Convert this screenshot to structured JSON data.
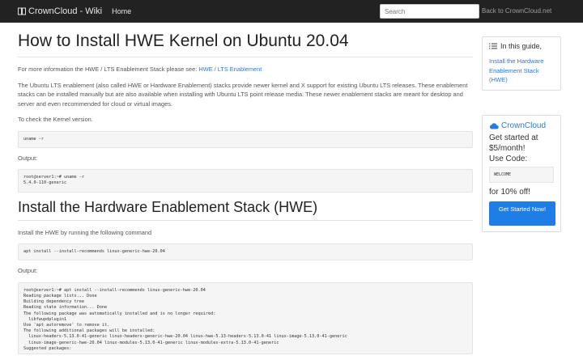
{
  "navbar": {
    "brand": "CrownCloud - Wiki",
    "home": "Home",
    "search_placeholder": "Search",
    "back_link": "Back to CrownCloud.net"
  },
  "main": {
    "title": "How to Install HWE Kernel on Ubuntu 20.04",
    "intro_prefix": "For more information the HWE / LTS Enablement Stack please see:",
    "intro_link": "HWE / LTS Enablement",
    "description": "The Ubuntu LTS enablement (also called HWE or Hardware Enablement) stacks provide newer kernel and X support for existing Ubuntu LTS releases. These enablement stacks can be installed manually but are also available when installing with Ubuntu LTS point release media. These newer enablement stacks are meant for desktop and server and even recommended for cloud or virtual images.",
    "check_kernel": "To check the Kernel version.",
    "cmd_uname": "uname -r",
    "output_label_1": "Output:",
    "output_uname": "root@server1:~# uname -r\n5.4.0-110-generic",
    "section_title": "Install the Hardware Enablement Stack (HWE)",
    "install_text": "Install the HWE by running the following command",
    "cmd_install": "apt install --install-recommends linux-generic-hwe-20.04",
    "output_label_2": "Output:",
    "output_install": "root@server1:~# apt install --install-recommends linux-generic-hwe-20.04\nReading package lists... Done\nBuilding dependency tree\nReading state information... Done\nThe following package was automatically installed and is no longer required:\n  libfwupdplugin1\nUse 'apt autoremove' to remove it.\nThe following additional packages will be installed:\n  linux-headers-5.13.0-41-generic linux-headers-generic-hwe-20.04 linux-hwe-5.13-headers-5.13.0-41 linux-image-5.13.0-41-generic\n  linux-image-generic-hwe-20.04 linux-modules-5.13.0-41-generic linux-modules-extra-5.13.0-41-generic\nSuggested packages:"
  },
  "sidebar": {
    "toc_title": "In this guide,",
    "toc_link": "Install the Hardware Enablement Stack (HWE)",
    "promo_brand": "CrownCloud",
    "promo_text": "Get started at $5/month!",
    "use_code": "Use Code:",
    "code": "WELCOME",
    "discount": "for 10% off!",
    "cta": "Get Started Now!"
  },
  "colors": {
    "navbar": "#222222",
    "link": "#2a7ae2",
    "button": "#1f7ee6"
  },
  "icons": [
    "book-icon",
    "list-icon",
    "cloud-icon"
  ]
}
